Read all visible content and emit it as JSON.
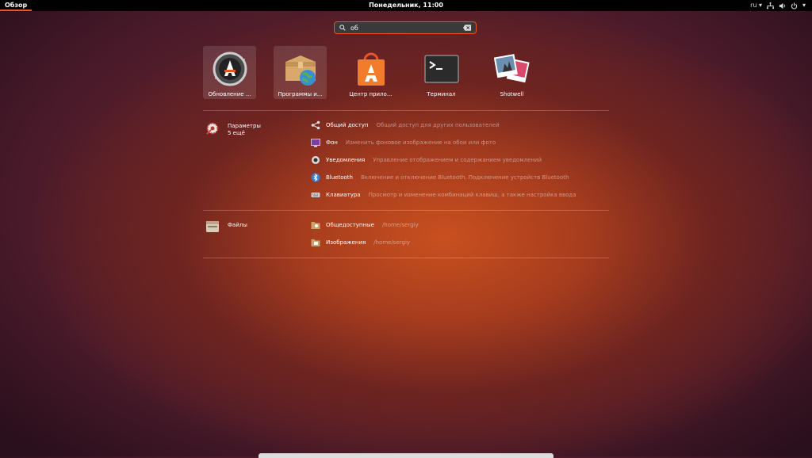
{
  "topbar": {
    "activities": "Обзор",
    "clock": "Понедельник, 11:00",
    "lang": "ru",
    "lang_arrow": "▾",
    "menu_arrow": "▾"
  },
  "search": {
    "value": "об"
  },
  "apps": [
    {
      "label": "Обновление ...",
      "icon": "software-updater-icon",
      "selected": true
    },
    {
      "label": "Программы и...",
      "icon": "software-properties-icon",
      "selected": true
    },
    {
      "label": "Центр прило...",
      "icon": "ubuntu-software-icon",
      "selected": false
    },
    {
      "label": "Терминал",
      "icon": "terminal-icon",
      "selected": false
    },
    {
      "label": "Shotwell",
      "icon": "shotwell-icon",
      "selected": false
    }
  ],
  "providers": [
    {
      "name": "Параметры",
      "more": "5 ещё",
      "icon": "settings-icon",
      "results": [
        {
          "title": "Общий доступ",
          "desc": "Общий доступ для других пользователей",
          "icon": "share-icon"
        },
        {
          "title": "Фон",
          "desc": "Изменить фоновое изображение на обои или фото",
          "icon": "background-icon"
        },
        {
          "title": "Уведомления",
          "desc": "Управление отображением и содержанием уведомлений",
          "icon": "notifications-icon"
        },
        {
          "title": "Bluetooth",
          "desc": "Включение и отключение Bluetooth. Подключение устройств Bluetooth",
          "icon": "bluetooth-icon"
        },
        {
          "title": "Клавиатура",
          "desc": "Просмотр и изменение комбинаций клавиш, а также настройка ввода",
          "icon": "keyboard-icon"
        }
      ]
    },
    {
      "name": "Файлы",
      "icon": "files-icon",
      "results": [
        {
          "title": "Общедоступные",
          "desc": "/home/sergiy",
          "icon": "public-folder-icon"
        },
        {
          "title": "Изображения",
          "desc": "/home/sergiy",
          "icon": "pictures-folder-icon"
        }
      ]
    }
  ]
}
